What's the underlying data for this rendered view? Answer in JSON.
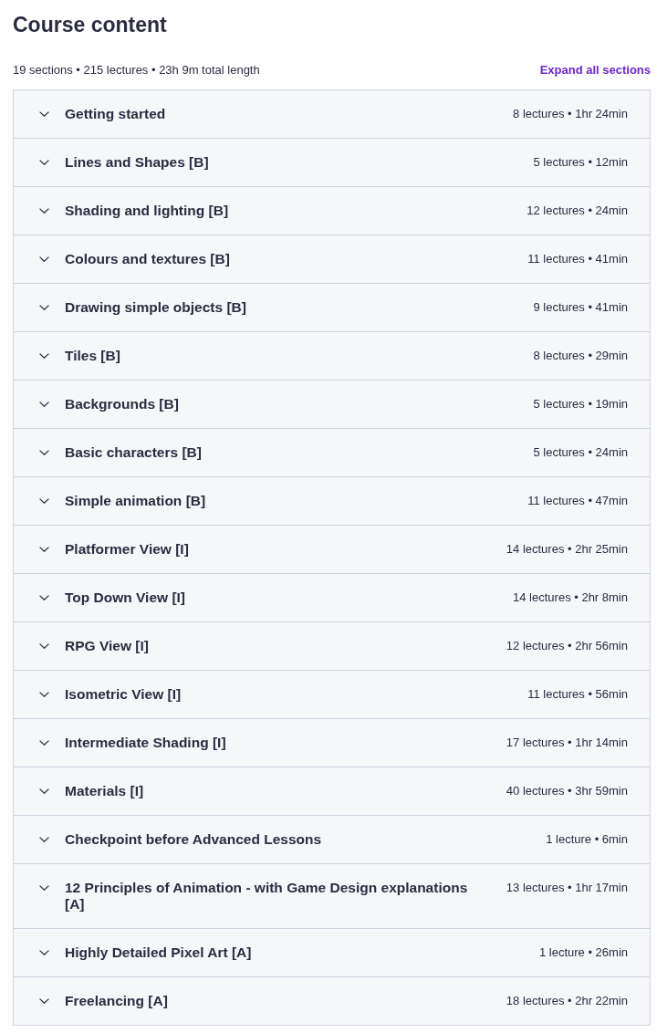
{
  "heading": "Course content",
  "summary": "19 sections • 215 lectures • 23h 9m total length",
  "expand_all": "Expand all sections",
  "sections": [
    {
      "title": "Getting started",
      "info": "8 lectures • 1hr 24min",
      "expanded": false
    },
    {
      "title": "Lines and Shapes [B]",
      "info": "5 lectures • 12min",
      "expanded": false
    },
    {
      "title": "Shading and lighting [B]",
      "info": "12 lectures • 24min",
      "expanded": false
    },
    {
      "title": "Colours and textures [B]",
      "info": "11 lectures • 41min",
      "expanded": false
    },
    {
      "title": "Drawing simple objects [B]",
      "info": "9 lectures • 41min",
      "expanded": false
    },
    {
      "title": "Tiles [B]",
      "info": "8 lectures • 29min",
      "expanded": false
    },
    {
      "title": "Backgrounds [B]",
      "info": "5 lectures • 19min",
      "expanded": false
    },
    {
      "title": "Basic characters [B]",
      "info": "5 lectures • 24min",
      "expanded": false
    },
    {
      "title": "Simple animation [B]",
      "info": "11 lectures • 47min",
      "expanded": false
    },
    {
      "title": "Platformer View [I]",
      "info": "14 lectures • 2hr 25min",
      "expanded": false
    },
    {
      "title": "Top Down View [I]",
      "info": "14 lectures • 2hr 8min",
      "expanded": false
    },
    {
      "title": "RPG View [I]",
      "info": "12 lectures • 2hr 56min",
      "expanded": false
    },
    {
      "title": "Isometric View [I]",
      "info": "11 lectures • 56min",
      "expanded": false
    },
    {
      "title": "Intermediate Shading [I]",
      "info": "17 lectures • 1hr 14min",
      "expanded": false
    },
    {
      "title": "Materials [I]",
      "info": "40 lectures • 3hr 59min",
      "expanded": false
    },
    {
      "title": "Checkpoint before Advanced Lessons",
      "info": "1 lecture • 6min",
      "expanded": false
    },
    {
      "title": "12 Principles of Animation - with Game Design explanations [A]",
      "info": "13 lectures • 1hr 17min",
      "expanded": false
    },
    {
      "title": "Highly Detailed Pixel Art [A]",
      "info": "1 lecture • 26min",
      "expanded": false
    },
    {
      "title": "Freelancing [A]",
      "info": "18 lectures • 2hr 22min",
      "expanded": false
    }
  ]
}
